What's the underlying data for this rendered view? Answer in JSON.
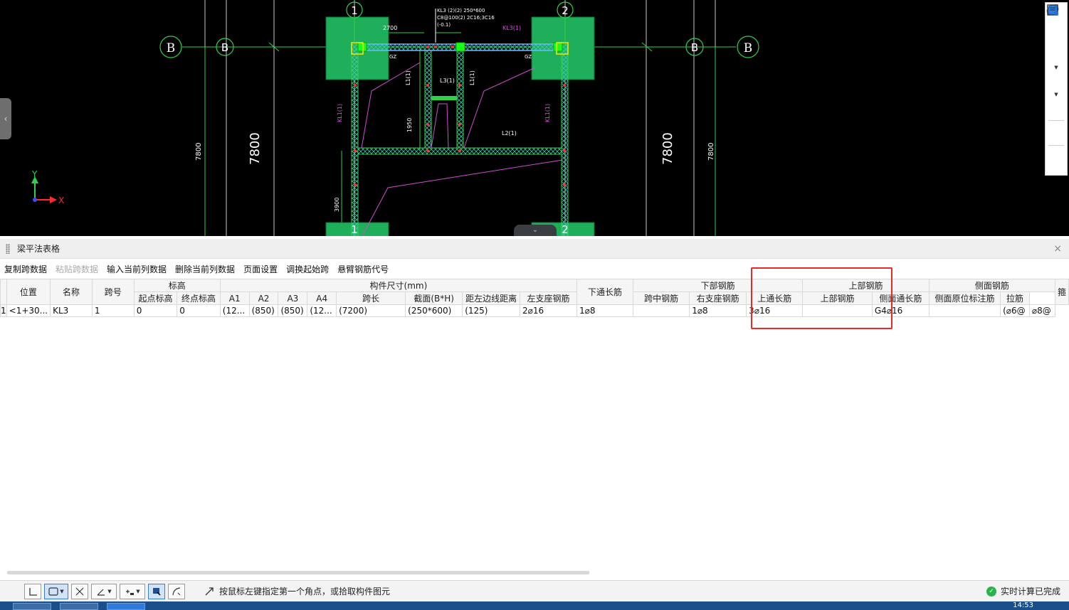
{
  "cad": {
    "axis_top_1": "1",
    "axis_top_2": "2",
    "axis_bottom_1": "1",
    "axis_bottom_2": "2",
    "axis_b": "B",
    "axis_b_prime": "B",
    "dim_7800": "7800",
    "dim_7800_small": "7800",
    "dim_2700": "2700",
    "dim_1950": "1950",
    "dim_3900": "3900",
    "beam_note_line1": "KL3 (2)(2) 250*600",
    "beam_note_line2": "C8@100(2) 2C16;3C16",
    "beam_note_line3": "(-0.1)",
    "label_kl1": "KL1(1)",
    "label_kl3": "KL3(1)",
    "label_l1": "L1(1)",
    "label_l2": "L2(1)",
    "label_l3": "L3(1)",
    "label_gz_left": "GZ",
    "label_gz_right": "GZ",
    "axis_x": "X",
    "axis_y": "Y"
  },
  "panel": {
    "title": "梁平法表格",
    "close": "×"
  },
  "actions": [
    {
      "label": "复制跨数据",
      "enabled": true
    },
    {
      "label": "粘贴跨数据",
      "enabled": false
    },
    {
      "label": "输入当前列数据",
      "enabled": true
    },
    {
      "label": "删除当前列数据",
      "enabled": true
    },
    {
      "label": "页面设置",
      "enabled": true
    },
    {
      "label": "调换起始跨",
      "enabled": true
    },
    {
      "label": "悬臂钢筋代号",
      "enabled": true
    }
  ],
  "table": {
    "headers": {
      "position": "位置",
      "name": "名称",
      "span": "跨号",
      "elevation": "标高",
      "elev_start": "起点标高",
      "elev_end": "终点标高",
      "dims": "构件尺寸(mm)",
      "a1": "A1",
      "a2": "A2",
      "a3": "A3",
      "a4": "A4",
      "span_len": "跨长",
      "section": "截面(B*H)",
      "offset": "距左边线距离",
      "bottom_through": "下通长筋",
      "bottom_rebar": "下部钢筋",
      "left_support": "左支座钢筋",
      "mid_span": "跨中钢筋",
      "right_support": "右支座钢筋",
      "top_rebar": "上部钢筋",
      "top_through": "上通长筋",
      "top_rebar_sub": "上部钢筋",
      "side_rebar": "侧面钢筋",
      "side_through": "侧面通长筋",
      "side_original": "侧面原位标注筋",
      "tie": "拉筋",
      "stirrup": "箍"
    },
    "rows": [
      {
        "rownum": "1",
        "position": "<1+30...",
        "name": "KL3",
        "span": "1",
        "elev_start": "0",
        "elev_end": "0",
        "a1": "(12...",
        "a2": "(850)",
        "a3": "(850)",
        "a4": "(12...",
        "span_len": "(7200)",
        "section": "(250*600)",
        "offset": "(125)",
        "bottom_through": "2⌀16",
        "left_support": "1⌀8",
        "mid_span": "",
        "right_support": "1⌀8",
        "top_through": "3⌀16",
        "top_rebar_sub": "",
        "side_through": "G4⌀16",
        "side_original": "",
        "tie": "(⌀6@",
        "stirrup": "⌀8@"
      }
    ]
  },
  "statusbar": {
    "hint": "按鼠标左键指定第一个角点，或拾取构件图元",
    "status": "实时计算已完成"
  },
  "taskbar": {
    "clock": "14:53"
  },
  "colors": {
    "cad_background": "#000000",
    "column_fill": "#1fae5a",
    "highlight_box": "#e52a2a",
    "ok_green": "#2bb24c"
  }
}
